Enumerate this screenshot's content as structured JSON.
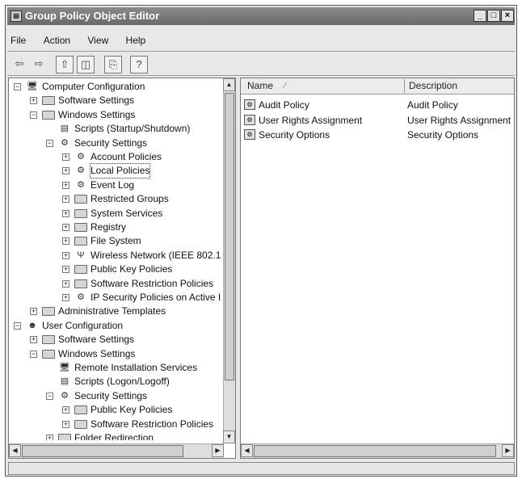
{
  "window": {
    "title": "Group Policy Object Editor",
    "controls": {
      "minimize": "_",
      "maximize": "□",
      "close": "×"
    }
  },
  "menu": [
    "File",
    "Action",
    "View",
    "Help"
  ],
  "toolbar": {
    "icons": [
      "back-arrow-icon",
      "forward-arrow-icon",
      "up-folder-icon",
      "show-hide-tree-icon",
      "export-list-icon",
      "help-icon"
    ]
  },
  "tree": [
    {
      "label": "Computer Configuration",
      "level": 0,
      "expander": "-",
      "icon": "computer-icon"
    },
    {
      "label": "Software Settings",
      "level": 1,
      "expander": "+",
      "icon": "folder-icon"
    },
    {
      "label": "Windows Settings",
      "level": 1,
      "expander": "-",
      "icon": "folder-icon"
    },
    {
      "label": "Scripts (Startup/Shutdown)",
      "level": 2,
      "expander": "",
      "icon": "script-icon"
    },
    {
      "label": "Security Settings",
      "level": 2,
      "expander": "-",
      "icon": "security-icon"
    },
    {
      "label": "Account Policies",
      "level": 3,
      "expander": "+",
      "icon": "policy-icon"
    },
    {
      "label": "Local Policies",
      "level": 3,
      "expander": "+",
      "icon": "policy-icon",
      "selected": true
    },
    {
      "label": "Event Log",
      "level": 3,
      "expander": "+",
      "icon": "policy-icon"
    },
    {
      "label": "Restricted Groups",
      "level": 3,
      "expander": "+",
      "icon": "folder-icon"
    },
    {
      "label": "System Services",
      "level": 3,
      "expander": "+",
      "icon": "folder-icon"
    },
    {
      "label": "Registry",
      "level": 3,
      "expander": "+",
      "icon": "folder-icon"
    },
    {
      "label": "File System",
      "level": 3,
      "expander": "+",
      "icon": "folder-icon"
    },
    {
      "label": "Wireless Network (IEEE 802.1",
      "level": 3,
      "expander": "+",
      "icon": "antenna-icon"
    },
    {
      "label": "Public Key Policies",
      "level": 3,
      "expander": "+",
      "icon": "folder-icon"
    },
    {
      "label": "Software Restriction Policies",
      "level": 3,
      "expander": "+",
      "icon": "folder-icon"
    },
    {
      "label": "IP Security Policies on Active I",
      "level": 3,
      "expander": "+",
      "icon": "ipsec-icon"
    },
    {
      "label": "Administrative Templates",
      "level": 1,
      "expander": "+",
      "icon": "folder-icon"
    },
    {
      "label": "User Configuration",
      "level": 0,
      "expander": "-",
      "icon": "user-icon"
    },
    {
      "label": "Software Settings",
      "level": 1,
      "expander": "+",
      "icon": "folder-icon"
    },
    {
      "label": "Windows Settings",
      "level": 1,
      "expander": "-",
      "icon": "folder-icon"
    },
    {
      "label": "Remote Installation Services",
      "level": 2,
      "expander": "",
      "icon": "computer-icon"
    },
    {
      "label": "Scripts (Logon/Logoff)",
      "level": 2,
      "expander": "",
      "icon": "script-icon"
    },
    {
      "label": "Security Settings",
      "level": 2,
      "expander": "-",
      "icon": "security-icon"
    },
    {
      "label": "Public Key Policies",
      "level": 3,
      "expander": "+",
      "icon": "folder-icon"
    },
    {
      "label": "Software Restriction Policies",
      "level": 3,
      "expander": "+",
      "icon": "folder-icon"
    },
    {
      "label": "Folder Redirection",
      "level": 2,
      "expander": "+",
      "icon": "folder-icon"
    }
  ],
  "listview": {
    "columns": [
      "Name",
      "Description"
    ],
    "rows": [
      {
        "name": "Audit Policy",
        "description": "Audit Policy"
      },
      {
        "name": "User Rights Assignment",
        "description": "User Rights Assignment"
      },
      {
        "name": "Security Options",
        "description": "Security Options"
      }
    ]
  }
}
